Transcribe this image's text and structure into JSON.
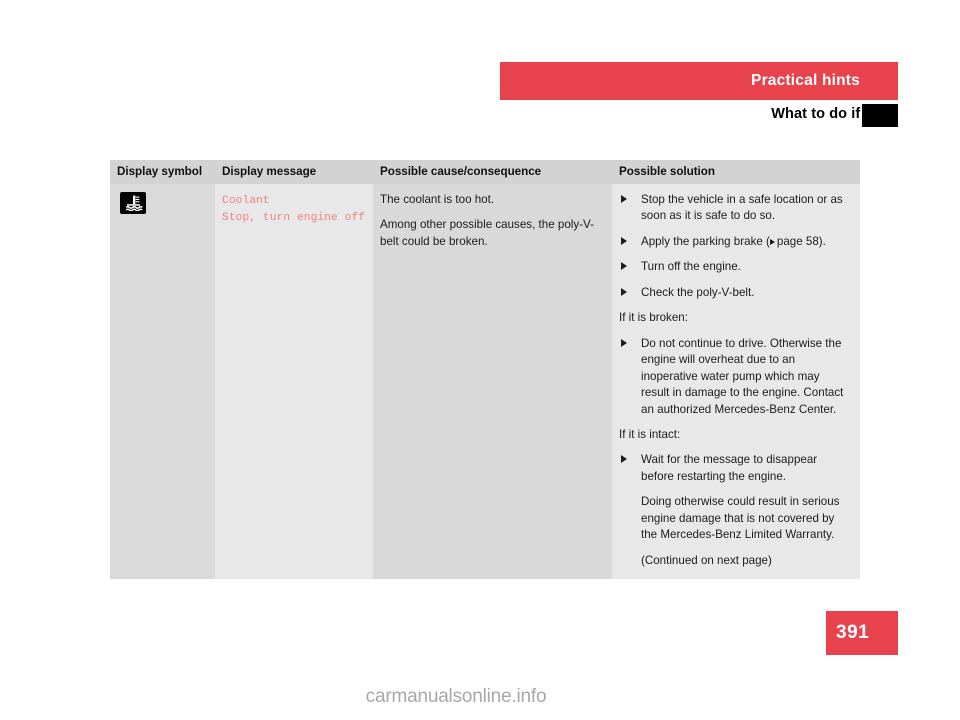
{
  "header": {
    "band_title": "Practical hints",
    "subtitle": "What to do if …?",
    "band_color": "#e8434c",
    "tab_marker_color": "#000000"
  },
  "table": {
    "columns": [
      "Display symbol",
      "Display message",
      "Possible cause/consequence",
      "Possible solution"
    ],
    "row": {
      "symbol": {
        "icon_name": "coolant-temperature-warning-icon",
        "background": "#000000",
        "glyph_color": "#ffffff"
      },
      "message": {
        "text": "Coolant\nStop, turn engine off",
        "line1": "Coolant",
        "line2": "Stop, turn engine off",
        "color": "#f08080"
      },
      "cause": [
        "The coolant is too hot.",
        "Among other possible causes, the poly-V-belt could be broken."
      ],
      "solution": {
        "bullets_primary": [
          "Stop the vehicle in a safe location or as soon as it is safe to do so.",
          "Apply the parking brake (",
          "Turn off the engine.",
          "Check the poly-V-belt."
        ],
        "parking_brake_prefix": "Apply the parking brake (",
        "parking_brake_reference": "page 58).",
        "heading_broken": "If it is broken:",
        "bullet_broken": "Do not continue to drive. Otherwise the engine will overheat due to an inoperative water pump which may result in damage to the engine. Contact an authorized Mercedes-Benz Center.",
        "heading_intact": "If it is intact:",
        "bullet_intact": "Wait for the message to disappear before restarting the engine.",
        "note_intact": "Doing otherwise could result in serious engine damage that is not covered by the Mercedes-Benz Limited Warranty.",
        "continued": "(Continued on next page)"
      }
    }
  },
  "footer": {
    "page_number": "391",
    "page_number_bg": "#e8434c",
    "watermark": "carmanualsonline.info"
  }
}
